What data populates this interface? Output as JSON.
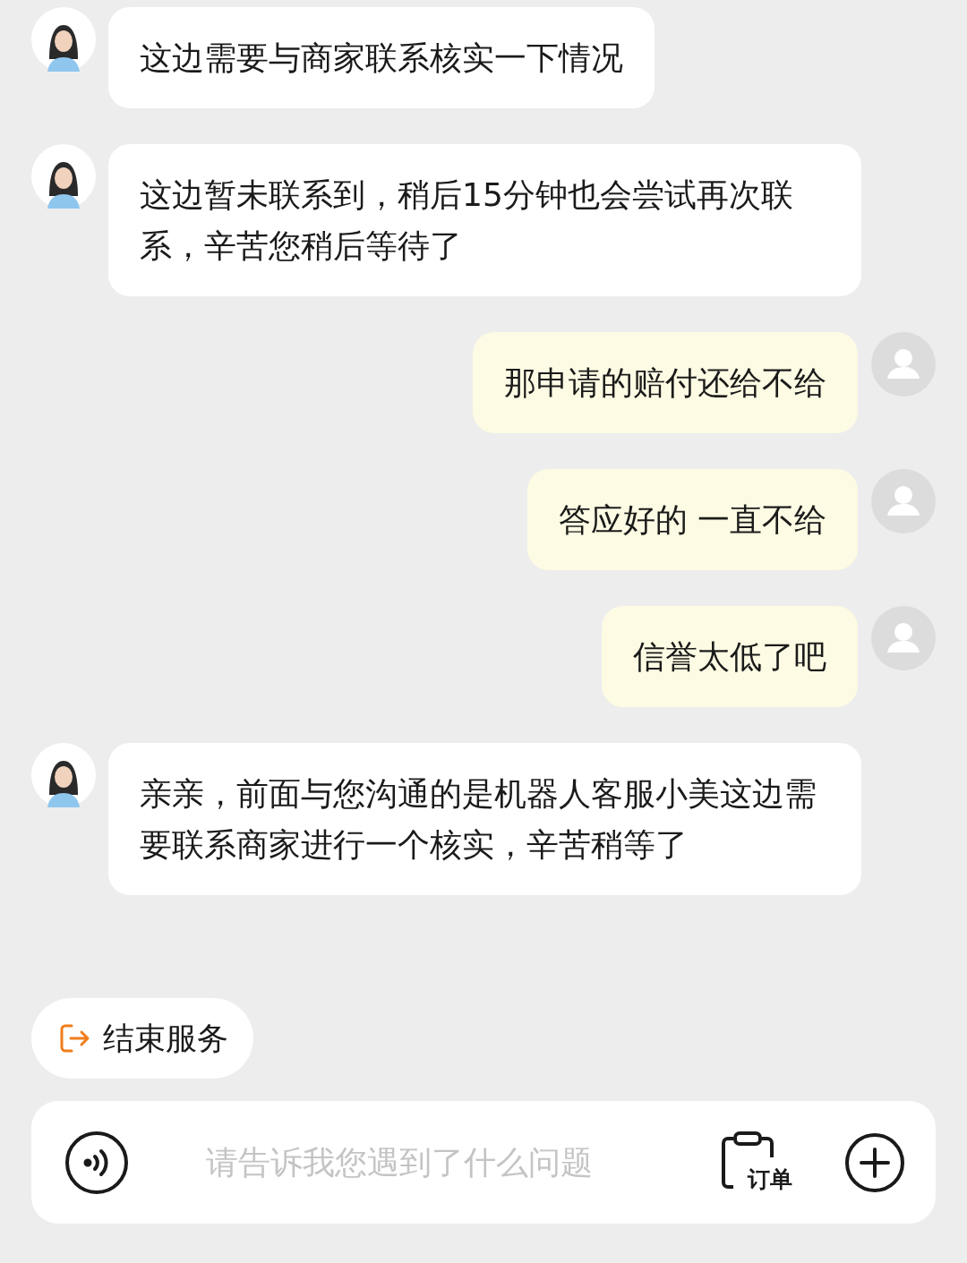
{
  "messages": [
    {
      "kind": "agent",
      "text": "这边需要与商家联系核实一下情况"
    },
    {
      "kind": "agent",
      "text": "这边暂未联系到，稍后15分钟也会尝试再次联系，辛苦您稍后等待了"
    },
    {
      "kind": "user",
      "text": "那申请的赔付还给不给"
    },
    {
      "kind": "user",
      "text": "答应好的 一直不给"
    },
    {
      "kind": "user",
      "text": "信誉太低了吧"
    },
    {
      "kind": "agent",
      "text": "亲亲，前面与您沟通的是机器人客服小美这边需要联系商家进行一个核实，辛苦稍等了"
    }
  ],
  "end_service": {
    "label": "结束服务"
  },
  "input": {
    "placeholder": "请告诉我您遇到了什么问题"
  },
  "order_button": {
    "label": "订单"
  }
}
